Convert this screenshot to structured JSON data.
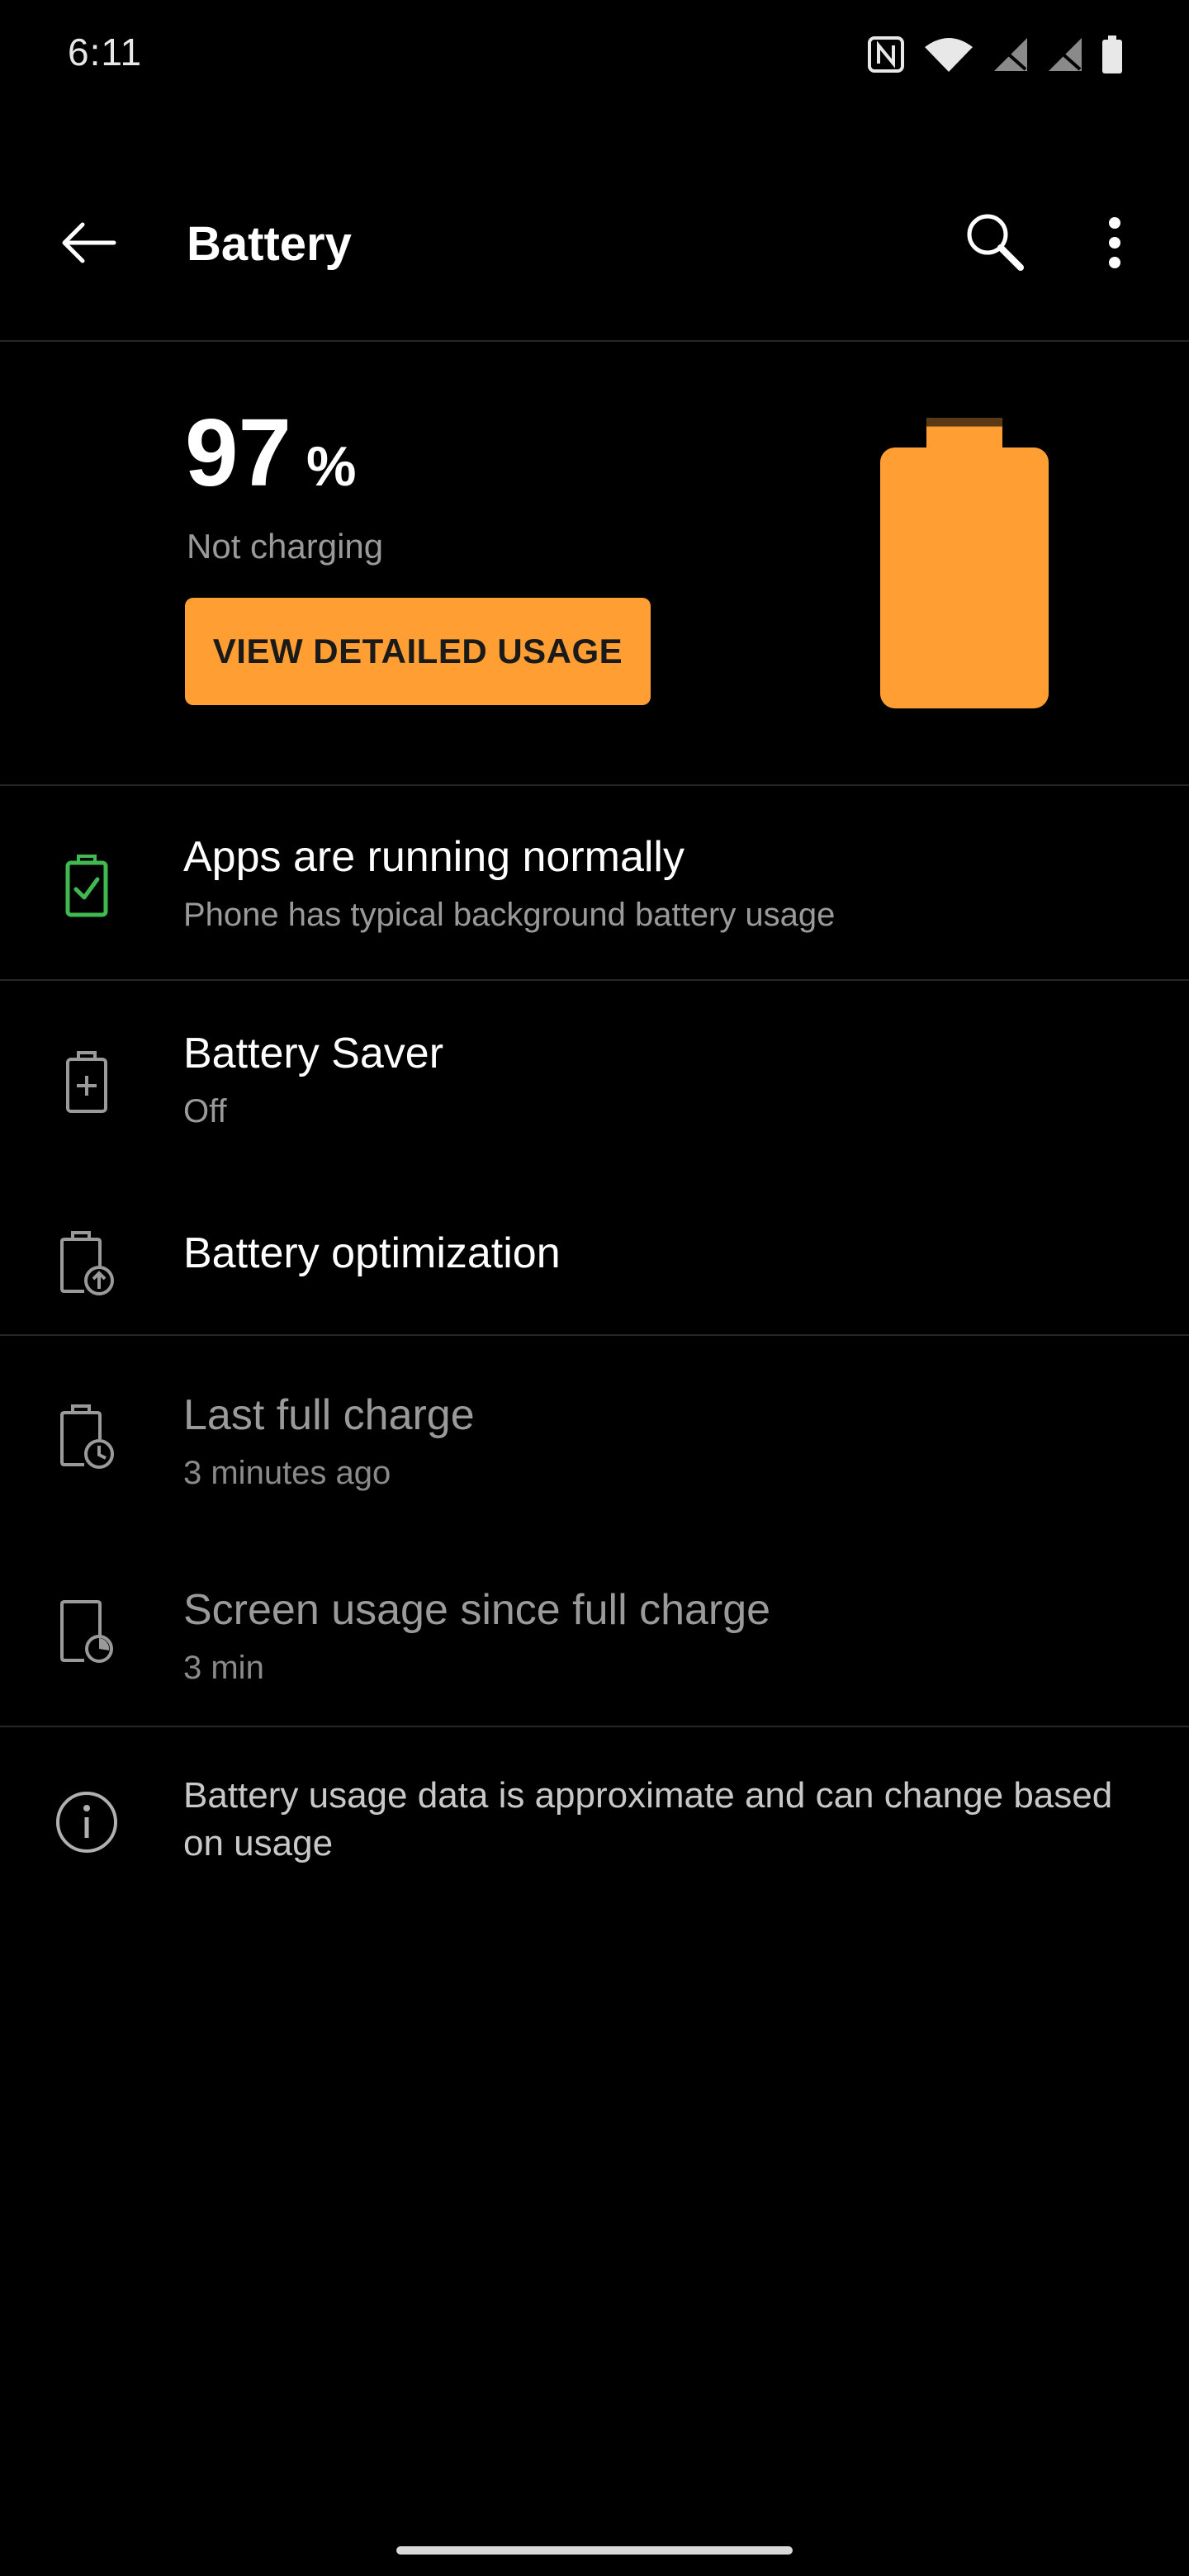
{
  "status_bar": {
    "time": "6:11",
    "icons": [
      "nfc-icon",
      "wifi-icon",
      "signal-off-icon",
      "signal-off-icon",
      "battery-icon"
    ]
  },
  "app_bar": {
    "title": "Battery",
    "back_icon": "back-arrow-icon",
    "search_icon": "search-icon",
    "more_icon": "more-vert-icon"
  },
  "battery": {
    "percent": "97",
    "percent_sign": "%",
    "level": 0.97,
    "status": "Not charging",
    "detail_button_label": "VIEW DETAILED USAGE",
    "color": "#ff9e33"
  },
  "items": [
    {
      "title": "Apps are running normally",
      "subtitle": "Phone has typical background battery usage",
      "icon": "battery-check-icon",
      "icon_color": "#3fb950"
    },
    {
      "title": "Battery Saver",
      "subtitle": "Off",
      "icon": "battery-plus-icon"
    },
    {
      "title": "Battery optimization",
      "icon": "battery-upload-icon"
    },
    {
      "title": "Last full charge",
      "subtitle": "3 minutes ago",
      "icon": "battery-clock-icon"
    },
    {
      "title": "Screen usage since full charge",
      "subtitle": "3 min",
      "icon": "screen-usage-icon"
    }
  ],
  "footnote": {
    "text": "Battery usage data is approximate and can change based on usage",
    "icon": "info-icon"
  },
  "colors": {
    "background": "#000000",
    "accent": "#ff9e33",
    "text_primary": "#ffffff",
    "text_secondary": "#9a9a9a",
    "divider": "#262626"
  }
}
